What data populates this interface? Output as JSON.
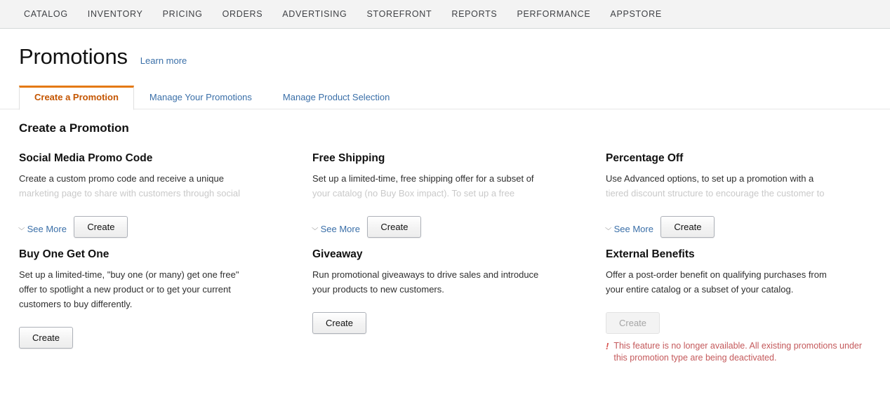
{
  "topnav": {
    "items": [
      {
        "label": "CATALOG",
        "name": "catalog"
      },
      {
        "label": "INVENTORY",
        "name": "inventory"
      },
      {
        "label": "PRICING",
        "name": "pricing"
      },
      {
        "label": "ORDERS",
        "name": "orders"
      },
      {
        "label": "ADVERTISING",
        "name": "advertising"
      },
      {
        "label": "STOREFRONT",
        "name": "storefront"
      },
      {
        "label": "REPORTS",
        "name": "reports"
      },
      {
        "label": "PERFORMANCE",
        "name": "performance"
      },
      {
        "label": "APPSTORE",
        "name": "appstore"
      }
    ]
  },
  "header": {
    "title": "Promotions",
    "learn_more": "Learn more"
  },
  "tabs": [
    {
      "label": "Create a Promotion",
      "active": true
    },
    {
      "label": "Manage Your Promotions",
      "active": false
    },
    {
      "label": "Manage Product Selection",
      "active": false
    }
  ],
  "section": {
    "title": "Create a Promotion"
  },
  "labels": {
    "see_more": "See More",
    "chevron_icon": "chevron-double-down",
    "create": "Create",
    "alert_icon": "!"
  },
  "colors": {
    "accent_orange": "#e47911",
    "link_blue": "#3a6fa8",
    "alert_red": "#c4595b",
    "nav_bg": "#f3f3f3"
  },
  "cards": [
    {
      "title": "Social Media Promo Code",
      "desc_line1": "Create a custom promo code and receive a unique",
      "desc_line2": "marketing page to share with customers through social",
      "desc_line3": "",
      "truncated": true,
      "button": "Create",
      "disabled": false
    },
    {
      "title": "Free Shipping",
      "desc_line1": "Set up a limited-time, free shipping offer for a subset of",
      "desc_line2": "your catalog (no Buy Box impact). To set up a free",
      "desc_line3": "",
      "truncated": true,
      "button": "Create",
      "disabled": false
    },
    {
      "title": "Percentage Off",
      "desc_line1": "Use Advanced options, to set up a promotion with a",
      "desc_line2": "tiered discount structure to encourage the customer to",
      "desc_line3": "",
      "truncated": true,
      "button": "Create",
      "disabled": false
    },
    {
      "title": "Buy One Get One",
      "desc_line1": "Set up a limited-time, \"buy one (or many) get one free\"",
      "desc_line2": "offer to spotlight a new product or to get your current",
      "desc_line3": "customers to buy differently.",
      "truncated": false,
      "button": "Create",
      "disabled": false
    },
    {
      "title": "Giveaway",
      "desc_line1": "Run promotional giveaways to drive sales and introduce",
      "desc_line2": "your products to new customers.",
      "desc_line3": "",
      "truncated": false,
      "button": "Create",
      "disabled": false
    },
    {
      "title": "External Benefits",
      "desc_line1": "Offer a post-order benefit on qualifying purchases from",
      "desc_line2": "your entire catalog or a subset of your catalog.",
      "desc_line3": "",
      "truncated": false,
      "button": "Create",
      "disabled": true,
      "alert": "This feature is no longer available. All existing promotions under this promotion type are being deactivated."
    }
  ]
}
